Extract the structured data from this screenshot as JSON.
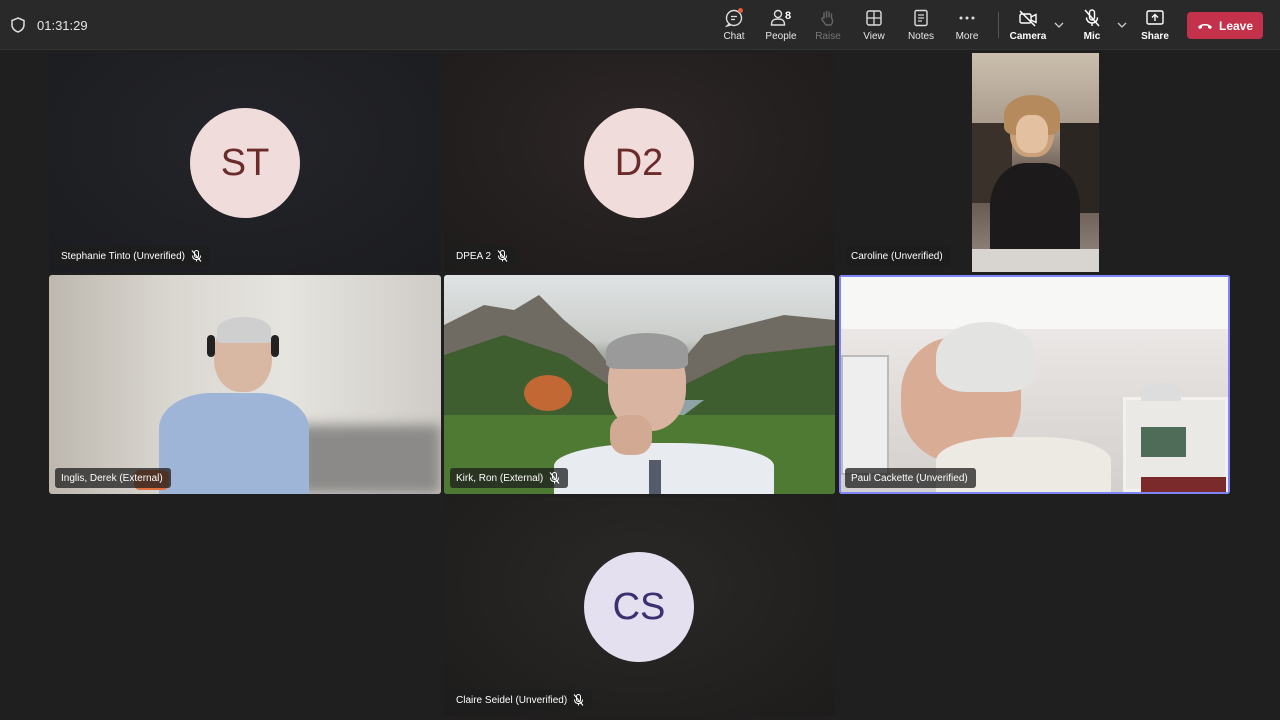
{
  "meeting": {
    "timer": "01:31:29"
  },
  "toolbar": {
    "chat": "Chat",
    "people": "People",
    "people_count": "8",
    "raise": "Raise",
    "view": "View",
    "notes": "Notes",
    "more": "More",
    "camera": "Camera",
    "mic": "Mic",
    "share": "Share",
    "leave": "Leave"
  },
  "participants": [
    {
      "name": "Stephanie Tinto (Unverified)",
      "initials": "ST",
      "muted": true,
      "video": false
    },
    {
      "name": "DPEA 2",
      "initials": "D2",
      "muted": true,
      "video": false
    },
    {
      "name": "Caroline (Unverified)",
      "muted": false,
      "video": true
    },
    {
      "name": "Inglis, Derek (External)",
      "muted": false,
      "video": true
    },
    {
      "name": "Kirk, Ron (External)",
      "muted": true,
      "video": true
    },
    {
      "name": "Paul Cackette (Unverified)",
      "muted": false,
      "video": true,
      "speaking": true
    },
    {
      "name": "Claire Seidel (Unverified)",
      "initials": "CS",
      "muted": true,
      "video": false
    }
  ],
  "colors": {
    "leave_button": "#c4314b",
    "active_speaker_border": "#7f85f5",
    "avatar_pink_bg": "#f1dcdc",
    "avatar_pink_text": "#6b2b2b",
    "avatar_lavender_bg": "#e4e0f0",
    "avatar_lavender_text": "#3b3170"
  }
}
